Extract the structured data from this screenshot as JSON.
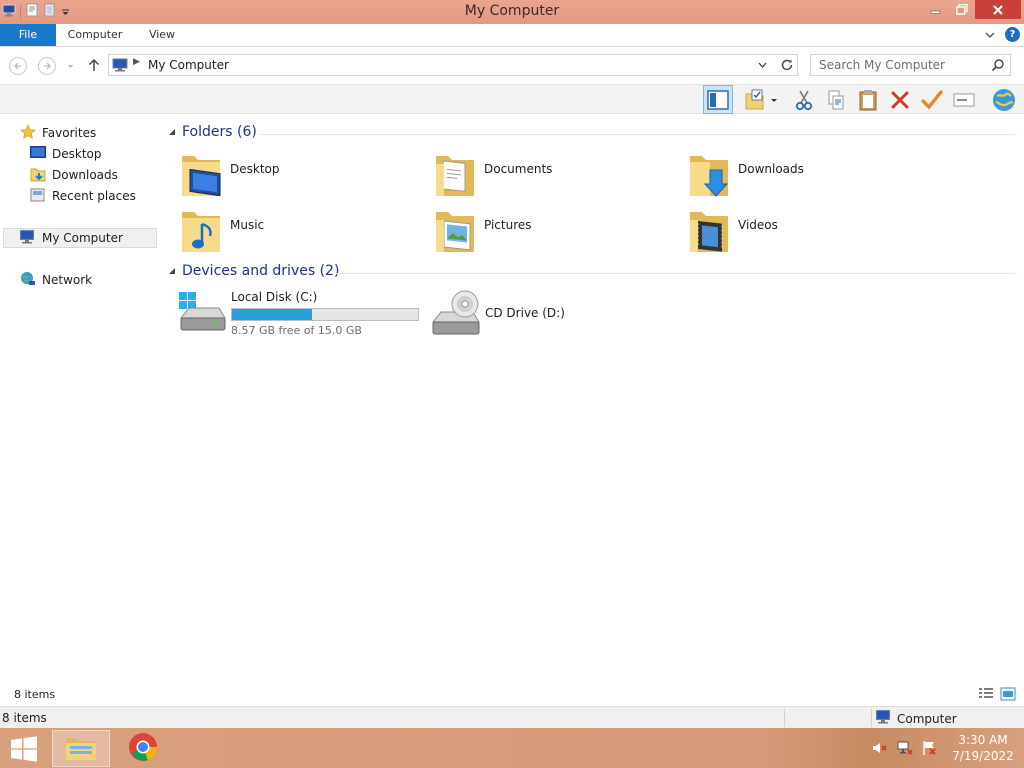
{
  "window": {
    "title": "My Computer"
  },
  "ribbon": {
    "tabs": [
      "File",
      "Computer",
      "View"
    ]
  },
  "address": {
    "path": "My Computer",
    "search_placeholder": "Search My Computer"
  },
  "nav": {
    "favorites": "Favorites",
    "favorites_items": [
      "Desktop",
      "Downloads",
      "Recent places"
    ],
    "computer": "My Computer",
    "network": "Network"
  },
  "content": {
    "folders_header": "Folders (6)",
    "folders": [
      "Desktop",
      "Documents",
      "Downloads",
      "Music",
      "Pictures",
      "Videos"
    ],
    "drives_header": "Devices and drives (2)",
    "drives": [
      {
        "name": "Local Disk (C:)",
        "free_text": "8.57 GB free of 15.0 GB",
        "used_fraction": 0.43
      },
      {
        "name": "CD Drive (D:)"
      }
    ]
  },
  "status": {
    "count": "8 items",
    "details_count": "8 items",
    "location": "Computer"
  },
  "taskbar": {
    "time": "3:30 AM",
    "date": "7/19/2022"
  },
  "colors": {
    "titlebar": "#e39a84",
    "accent": "#1979ca",
    "group_header": "#1e3287",
    "drive_fill": "#26a0da"
  }
}
